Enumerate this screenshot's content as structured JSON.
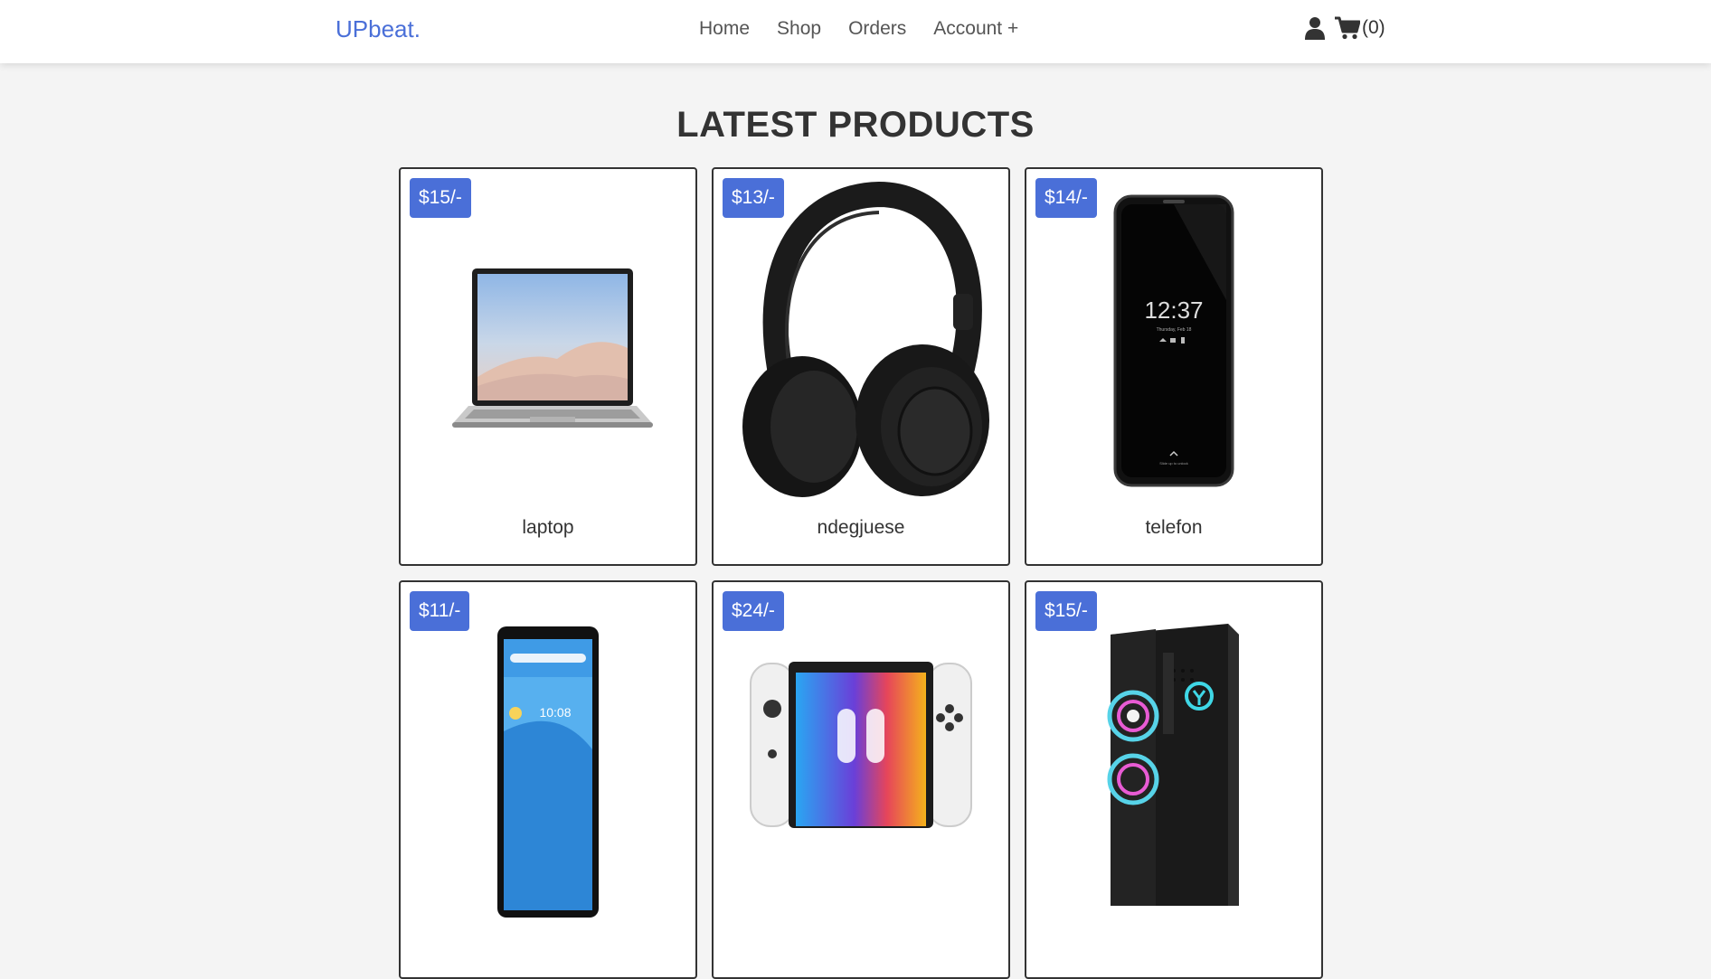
{
  "header": {
    "logo": "UPbeat.",
    "nav": [
      "Home",
      "Shop",
      "Orders",
      "Account +"
    ],
    "cart_count": "(0)",
    "accent": "#4a6fd8"
  },
  "main": {
    "title": "LATEST PRODUCTS",
    "products": [
      {
        "price": "$15/-",
        "name": "laptop",
        "image": "laptop"
      },
      {
        "price": "$13/-",
        "name": "ndegjuese",
        "image": "headphones"
      },
      {
        "price": "$14/-",
        "name": "telefon",
        "image": "smartphone"
      },
      {
        "price": "$11/-",
        "name": "",
        "image": "tablet"
      },
      {
        "price": "$24/-",
        "name": "",
        "image": "game-console"
      },
      {
        "price": "$15/-",
        "name": "",
        "image": "desktop-pc"
      }
    ],
    "phone_screen": {
      "time": "12:37",
      "date": "Thursday, Feb 18",
      "hint": "Slide up to unlock"
    },
    "tablet_screen": {
      "time": "10:08"
    }
  }
}
